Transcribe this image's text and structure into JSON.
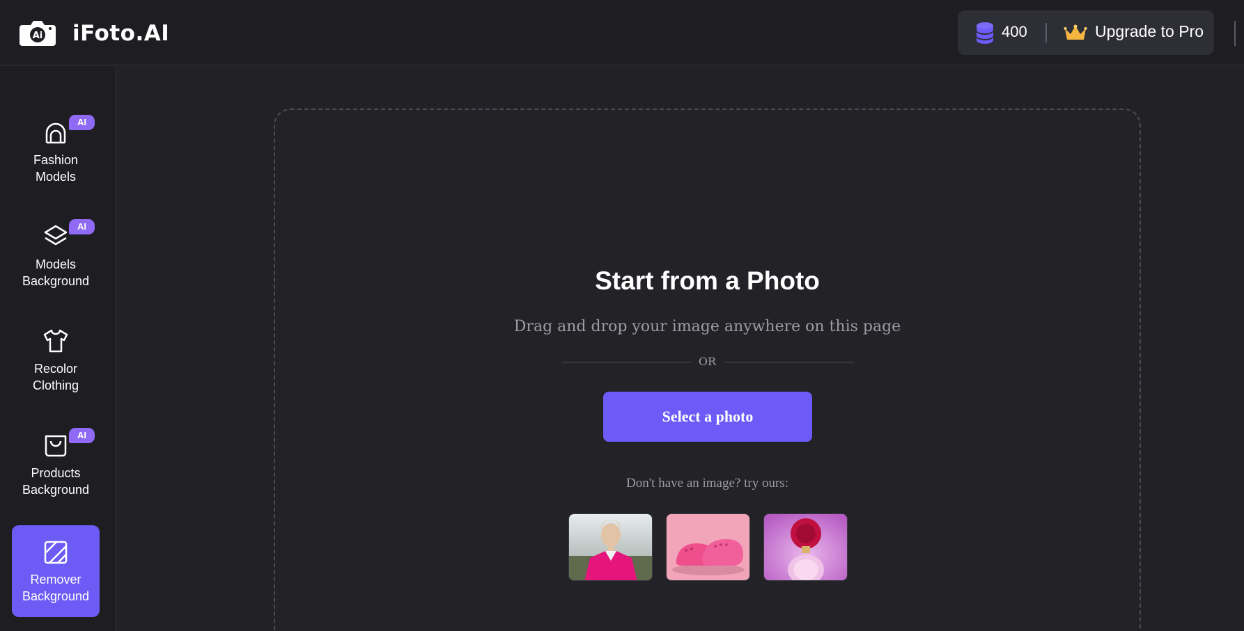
{
  "header": {
    "brand": "iFoto.AI",
    "credits": "400",
    "upgrade_label": "Upgrade to Pro",
    "icons": {
      "logo": "camera-ai-icon",
      "credits": "coin-stack-icon",
      "upgrade": "crown-icon"
    }
  },
  "sidebar": {
    "items": [
      {
        "label": "Fashion\nModels",
        "icon": "mannequin-icon",
        "badge": "AI",
        "active": false
      },
      {
        "label": "Models\nBackground",
        "icon": "layers-icon",
        "badge": "AI",
        "active": false
      },
      {
        "label": "Recolor\nClothing",
        "icon": "tshirt-icon",
        "badge": "",
        "active": false
      },
      {
        "label": "Products\nBackground",
        "icon": "shopping-bag-icon",
        "badge": "AI",
        "active": false
      },
      {
        "label": "Remover\nBackground",
        "icon": "erase-background-icon",
        "badge": "",
        "active": true
      }
    ]
  },
  "main": {
    "title": "Start from a Photo",
    "subtitle": "Drag and drop your image anywhere on this page",
    "or_text": "OR",
    "select_button": "Select a photo",
    "try_text": "Don't have an image? try ours:",
    "samples": [
      {
        "name": "sample-woman-pink-blazer"
      },
      {
        "name": "sample-pink-clogs"
      },
      {
        "name": "sample-pink-perfume"
      }
    ]
  },
  "colors": {
    "accent": "#6c5bf6",
    "badge": "#8f6af5",
    "background": "#212126",
    "panel": "#1d1d22"
  }
}
